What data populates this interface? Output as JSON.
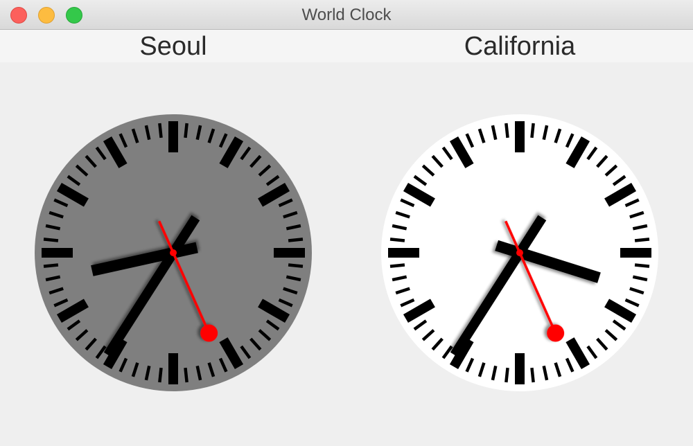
{
  "window": {
    "title": "World Clock",
    "buttons": {
      "close": "close",
      "minimize": "minimize",
      "zoom": "zoom"
    }
  },
  "clocks": [
    {
      "city": "Seoul",
      "face_color": "#7f7f7f",
      "hour": 8,
      "minute": 35,
      "second": 26
    },
    {
      "city": "California",
      "face_color": "#ffffff",
      "hour": 15,
      "minute": 35,
      "second": 26
    }
  ],
  "colors": {
    "hand": "#000000",
    "second_hand": "#ff0000"
  }
}
